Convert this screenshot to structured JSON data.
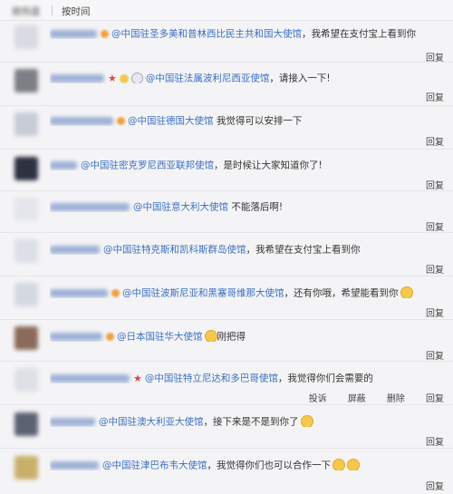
{
  "sort": {
    "hot": "按热度",
    "time": "按时间"
  },
  "reply": "回复",
  "more_actions": [
    "投诉",
    "屏蔽",
    "删除",
    "回复"
  ],
  "comments": [
    {
      "mention": "@中国驻圣多美和普林西比民主共和国大使馆",
      "text": "，我希望在支付宝上看到你"
    },
    {
      "mention": "@中国驻法属波利尼西亚使馆",
      "text": "，请接入一下!"
    },
    {
      "mention": "@中国驻德国大使馆",
      "text": " 我觉得可以安排一下"
    },
    {
      "mention": "@中国驻密克罗尼西亚联邦使馆",
      "text": "，是时候让大家知道你了!"
    },
    {
      "mention": "@中国驻意大利大使馆",
      "text": " 不能落后啊!"
    },
    {
      "mention": "@中国驻特克斯和凯科斯群岛使馆",
      "text": "，我希望在支付宝上看到你"
    },
    {
      "mention": "@中国驻波斯尼亚和黑塞哥维那大使馆",
      "text": "，还有你哦，希望能看到你"
    },
    {
      "mention": "@日本国驻华大使馆",
      "text": "刚把得"
    },
    {
      "mention": "@中国驻特立尼达和多巴哥使馆",
      "text": "，我觉得你们会需要的"
    },
    {
      "mention": "@中国驻澳大利亚大使馆",
      "text": "，接下来是不是到你了"
    },
    {
      "mention": "@中国驻津巴布韦大使馆",
      "text": "，我觉得你们也可以合作一下"
    }
  ],
  "colors": {
    "link": "#3b6fc4",
    "username_blur": "#9fb2d6",
    "background": "#f4f4f6"
  }
}
